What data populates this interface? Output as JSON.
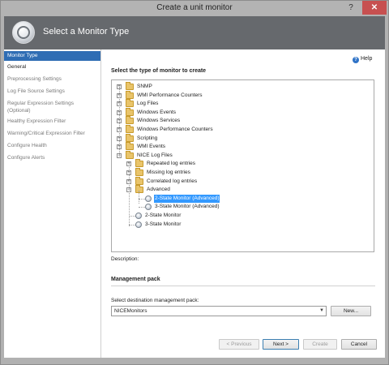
{
  "window": {
    "title": "Create a unit monitor",
    "help_glyph": "?",
    "close_glyph": "✕"
  },
  "header": {
    "title": "Select a Monitor Type",
    "icon": "monitor-orb-icon"
  },
  "nav": {
    "items": [
      {
        "label": "Monitor Type",
        "state": "selected"
      },
      {
        "label": "General",
        "state": "visited"
      },
      {
        "label": "Preprocessing Settings",
        "state": "pending"
      },
      {
        "label": "Log File Source Settings",
        "state": "pending"
      },
      {
        "label": "Regular Expression Settings",
        "label2": "(Optional)",
        "state": "pending"
      },
      {
        "label": "Healthy Expression Filter",
        "state": "pending"
      },
      {
        "label": "Warning/Critical Expression Filter",
        "state": "pending"
      },
      {
        "label": "Configure Health",
        "state": "pending"
      },
      {
        "label": "Configure Alerts",
        "state": "pending"
      }
    ]
  },
  "main": {
    "help_label": "Help",
    "section_label": "Select the type of monitor to create",
    "tree": [
      {
        "label": "SNMP",
        "kind": "folder",
        "expander": "+"
      },
      {
        "label": "WMI Performance Counters",
        "kind": "folder",
        "expander": "+"
      },
      {
        "label": "Log Files",
        "kind": "folder",
        "expander": "+"
      },
      {
        "label": "Windows Events",
        "kind": "folder",
        "expander": "+"
      },
      {
        "label": "Windows Services",
        "kind": "folder",
        "expander": "+"
      },
      {
        "label": "Windows Performance Counters",
        "kind": "folder",
        "expander": "+"
      },
      {
        "label": "Scripting",
        "kind": "folder",
        "expander": "+"
      },
      {
        "label": "WMI Events",
        "kind": "folder",
        "expander": "+"
      },
      {
        "label": "NICE Log Files",
        "kind": "folder",
        "expander": "−"
      },
      {
        "label": "Repeated log entries",
        "kind": "folder",
        "expander": "+"
      },
      {
        "label": "Missing log entries",
        "kind": "folder",
        "expander": "+"
      },
      {
        "label": "Correlated log entries",
        "kind": "folder",
        "expander": "+"
      },
      {
        "label": "Advanced",
        "kind": "folder",
        "expander": "−"
      },
      {
        "label": "2-State Monitor (Advanced)",
        "kind": "monitor",
        "selected": true
      },
      {
        "label": "3-State Monitor (Advanced)",
        "kind": "monitor"
      },
      {
        "label": "2-State Monitor",
        "kind": "monitor"
      },
      {
        "label": "3-State Monitor",
        "kind": "monitor"
      }
    ],
    "description_label": "Description:",
    "management_pack": {
      "title": "Management pack",
      "destination_label": "Select destination management pack:",
      "selected_value": "NICEMonitors",
      "new_button": "New..."
    }
  },
  "footer": {
    "previous_button": "< Previous",
    "next_button": "Next >",
    "create_button": "Create",
    "cancel_button": "Cancel"
  },
  "colors": {
    "header_bg": "#66696d",
    "nav_selected": "#2f6db4",
    "tree_selected": "#3399ff",
    "folder": "#e9c46a"
  }
}
